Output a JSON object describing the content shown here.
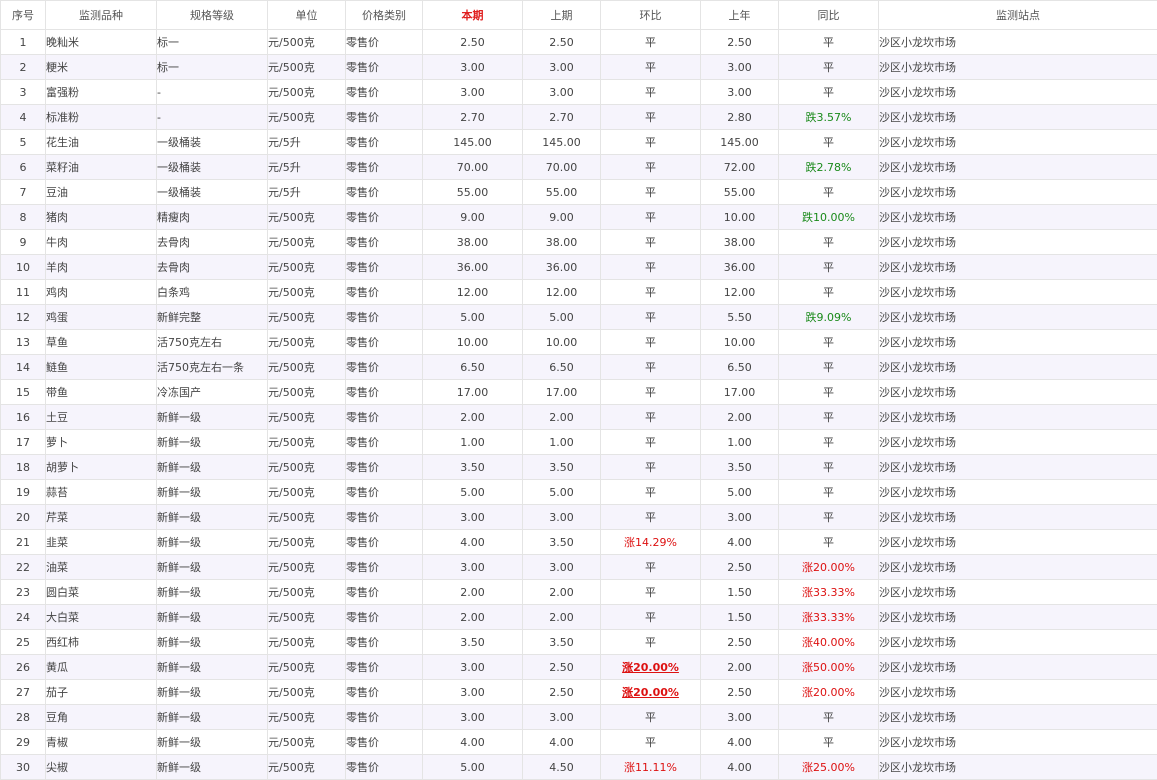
{
  "headers": [
    "序号",
    "监测品种",
    "规格等级",
    "单位",
    "价格类别",
    "本期",
    "上期",
    "环比",
    "上年",
    "同比",
    "监测站点"
  ],
  "rows": [
    {
      "no": "1",
      "name": "晚籼米",
      "spec": "标一",
      "unit": "元/500克",
      "type": "零售价",
      "cur": "2.50",
      "prev": "2.50",
      "mom": "平",
      "lastyear": "2.50",
      "yoy": "平",
      "site": "沙区小龙坎市场"
    },
    {
      "no": "2",
      "name": "粳米",
      "spec": "标一",
      "unit": "元/500克",
      "type": "零售价",
      "cur": "3.00",
      "prev": "3.00",
      "mom": "平",
      "lastyear": "3.00",
      "yoy": "平",
      "site": "沙区小龙坎市场"
    },
    {
      "no": "3",
      "name": "富强粉",
      "spec": "-",
      "unit": "元/500克",
      "type": "零售价",
      "cur": "3.00",
      "prev": "3.00",
      "mom": "平",
      "lastyear": "3.00",
      "yoy": "平",
      "site": "沙区小龙坎市场"
    },
    {
      "no": "4",
      "name": "标准粉",
      "spec": "-",
      "unit": "元/500克",
      "type": "零售价",
      "cur": "2.70",
      "prev": "2.70",
      "mom": "平",
      "lastyear": "2.80",
      "yoy": "跌3.57%",
      "site": "沙区小龙坎市场"
    },
    {
      "no": "5",
      "name": "花生油",
      "spec": "一级桶装",
      "unit": "元/5升",
      "type": "零售价",
      "cur": "145.00",
      "prev": "145.00",
      "mom": "平",
      "lastyear": "145.00",
      "yoy": "平",
      "site": "沙区小龙坎市场"
    },
    {
      "no": "6",
      "name": "菜籽油",
      "spec": "一级桶装",
      "unit": "元/5升",
      "type": "零售价",
      "cur": "70.00",
      "prev": "70.00",
      "mom": "平",
      "lastyear": "72.00",
      "yoy": "跌2.78%",
      "site": "沙区小龙坎市场"
    },
    {
      "no": "7",
      "name": "豆油",
      "spec": "一级桶装",
      "unit": "元/5升",
      "type": "零售价",
      "cur": "55.00",
      "prev": "55.00",
      "mom": "平",
      "lastyear": "55.00",
      "yoy": "平",
      "site": "沙区小龙坎市场"
    },
    {
      "no": "8",
      "name": "猪肉",
      "spec": "精瘦肉",
      "unit": "元/500克",
      "type": "零售价",
      "cur": "9.00",
      "prev": "9.00",
      "mom": "平",
      "lastyear": "10.00",
      "yoy": "跌10.00%",
      "site": "沙区小龙坎市场"
    },
    {
      "no": "9",
      "name": "牛肉",
      "spec": "去骨肉",
      "unit": "元/500克",
      "type": "零售价",
      "cur": "38.00",
      "prev": "38.00",
      "mom": "平",
      "lastyear": "38.00",
      "yoy": "平",
      "site": "沙区小龙坎市场"
    },
    {
      "no": "10",
      "name": "羊肉",
      "spec": "去骨肉",
      "unit": "元/500克",
      "type": "零售价",
      "cur": "36.00",
      "prev": "36.00",
      "mom": "平",
      "lastyear": "36.00",
      "yoy": "平",
      "site": "沙区小龙坎市场"
    },
    {
      "no": "11",
      "name": "鸡肉",
      "spec": "白条鸡",
      "unit": "元/500克",
      "type": "零售价",
      "cur": "12.00",
      "prev": "12.00",
      "mom": "平",
      "lastyear": "12.00",
      "yoy": "平",
      "site": "沙区小龙坎市场"
    },
    {
      "no": "12",
      "name": "鸡蛋",
      "spec": "新鲜完整",
      "unit": "元/500克",
      "type": "零售价",
      "cur": "5.00",
      "prev": "5.00",
      "mom": "平",
      "lastyear": "5.50",
      "yoy": "跌9.09%",
      "site": "沙区小龙坎市场"
    },
    {
      "no": "13",
      "name": "草鱼",
      "spec": "活750克左右",
      "unit": "元/500克",
      "type": "零售价",
      "cur": "10.00",
      "prev": "10.00",
      "mom": "平",
      "lastyear": "10.00",
      "yoy": "平",
      "site": "沙区小龙坎市场"
    },
    {
      "no": "14",
      "name": "鲢鱼",
      "spec": "活750克左右一条",
      "unit": "元/500克",
      "type": "零售价",
      "cur": "6.50",
      "prev": "6.50",
      "mom": "平",
      "lastyear": "6.50",
      "yoy": "平",
      "site": "沙区小龙坎市场"
    },
    {
      "no": "15",
      "name": "带鱼",
      "spec": "冷冻国产",
      "unit": "元/500克",
      "type": "零售价",
      "cur": "17.00",
      "prev": "17.00",
      "mom": "平",
      "lastyear": "17.00",
      "yoy": "平",
      "site": "沙区小龙坎市场"
    },
    {
      "no": "16",
      "name": "土豆",
      "spec": "新鲜一级",
      "unit": "元/500克",
      "type": "零售价",
      "cur": "2.00",
      "prev": "2.00",
      "mom": "平",
      "lastyear": "2.00",
      "yoy": "平",
      "site": "沙区小龙坎市场"
    },
    {
      "no": "17",
      "name": "萝卜",
      "spec": "新鲜一级",
      "unit": "元/500克",
      "type": "零售价",
      "cur": "1.00",
      "prev": "1.00",
      "mom": "平",
      "lastyear": "1.00",
      "yoy": "平",
      "site": "沙区小龙坎市场"
    },
    {
      "no": "18",
      "name": "胡萝卜",
      "spec": "新鲜一级",
      "unit": "元/500克",
      "type": "零售价",
      "cur": "3.50",
      "prev": "3.50",
      "mom": "平",
      "lastyear": "3.50",
      "yoy": "平",
      "site": "沙区小龙坎市场"
    },
    {
      "no": "19",
      "name": "蒜苔",
      "spec": "新鲜一级",
      "unit": "元/500克",
      "type": "零售价",
      "cur": "5.00",
      "prev": "5.00",
      "mom": "平",
      "lastyear": "5.00",
      "yoy": "平",
      "site": "沙区小龙坎市场"
    },
    {
      "no": "20",
      "name": "芹菜",
      "spec": "新鲜一级",
      "unit": "元/500克",
      "type": "零售价",
      "cur": "3.00",
      "prev": "3.00",
      "mom": "平",
      "lastyear": "3.00",
      "yoy": "平",
      "site": "沙区小龙坎市场"
    },
    {
      "no": "21",
      "name": "韭菜",
      "spec": "新鲜一级",
      "unit": "元/500克",
      "type": "零售价",
      "cur": "4.00",
      "prev": "3.50",
      "mom": "涨14.29%",
      "lastyear": "4.00",
      "yoy": "平",
      "site": "沙区小龙坎市场"
    },
    {
      "no": "22",
      "name": "油菜",
      "spec": "新鲜一级",
      "unit": "元/500克",
      "type": "零售价",
      "cur": "3.00",
      "prev": "3.00",
      "mom": "平",
      "lastyear": "2.50",
      "yoy": "涨20.00%",
      "site": "沙区小龙坎市场"
    },
    {
      "no": "23",
      "name": "圆白菜",
      "spec": "新鲜一级",
      "unit": "元/500克",
      "type": "零售价",
      "cur": "2.00",
      "prev": "2.00",
      "mom": "平",
      "lastyear": "1.50",
      "yoy": "涨33.33%",
      "site": "沙区小龙坎市场"
    },
    {
      "no": "24",
      "name": "大白菜",
      "spec": "新鲜一级",
      "unit": "元/500克",
      "type": "零售价",
      "cur": "2.00",
      "prev": "2.00",
      "mom": "平",
      "lastyear": "1.50",
      "yoy": "涨33.33%",
      "site": "沙区小龙坎市场"
    },
    {
      "no": "25",
      "name": "西红柿",
      "spec": "新鲜一级",
      "unit": "元/500克",
      "type": "零售价",
      "cur": "3.50",
      "prev": "3.50",
      "mom": "平",
      "lastyear": "2.50",
      "yoy": "涨40.00%",
      "site": "沙区小龙坎市场"
    },
    {
      "no": "26",
      "name": "黄瓜",
      "spec": "新鲜一级",
      "unit": "元/500克",
      "type": "零售价",
      "cur": "3.00",
      "prev": "2.50",
      "mom": "涨20.00%",
      "mom_bold": true,
      "lastyear": "2.00",
      "yoy": "涨50.00%",
      "site": "沙区小龙坎市场"
    },
    {
      "no": "27",
      "name": "茄子",
      "spec": "新鲜一级",
      "unit": "元/500克",
      "type": "零售价",
      "cur": "3.00",
      "prev": "2.50",
      "mom": "涨20.00%",
      "mom_bold": true,
      "lastyear": "2.50",
      "yoy": "涨20.00%",
      "site": "沙区小龙坎市场"
    },
    {
      "no": "28",
      "name": "豆角",
      "spec": "新鲜一级",
      "unit": "元/500克",
      "type": "零售价",
      "cur": "3.00",
      "prev": "3.00",
      "mom": "平",
      "lastyear": "3.00",
      "yoy": "平",
      "site": "沙区小龙坎市场"
    },
    {
      "no": "29",
      "name": "青椒",
      "spec": "新鲜一级",
      "unit": "元/500克",
      "type": "零售价",
      "cur": "4.00",
      "prev": "4.00",
      "mom": "平",
      "lastyear": "4.00",
      "yoy": "平",
      "site": "沙区小龙坎市场"
    },
    {
      "no": "30",
      "name": "尖椒",
      "spec": "新鲜一级",
      "unit": "元/500克",
      "type": "零售价",
      "cur": "5.00",
      "prev": "4.50",
      "mom": "涨11.11%",
      "lastyear": "4.00",
      "yoy": "涨25.00%",
      "site": "沙区小龙坎市场"
    }
  ],
  "colors": {
    "up": "#dd1111",
    "down": "#1a8a1a",
    "highlight_header": "#e02020",
    "alt_row": "#f6f4fc",
    "border": "#e4e4e4"
  }
}
